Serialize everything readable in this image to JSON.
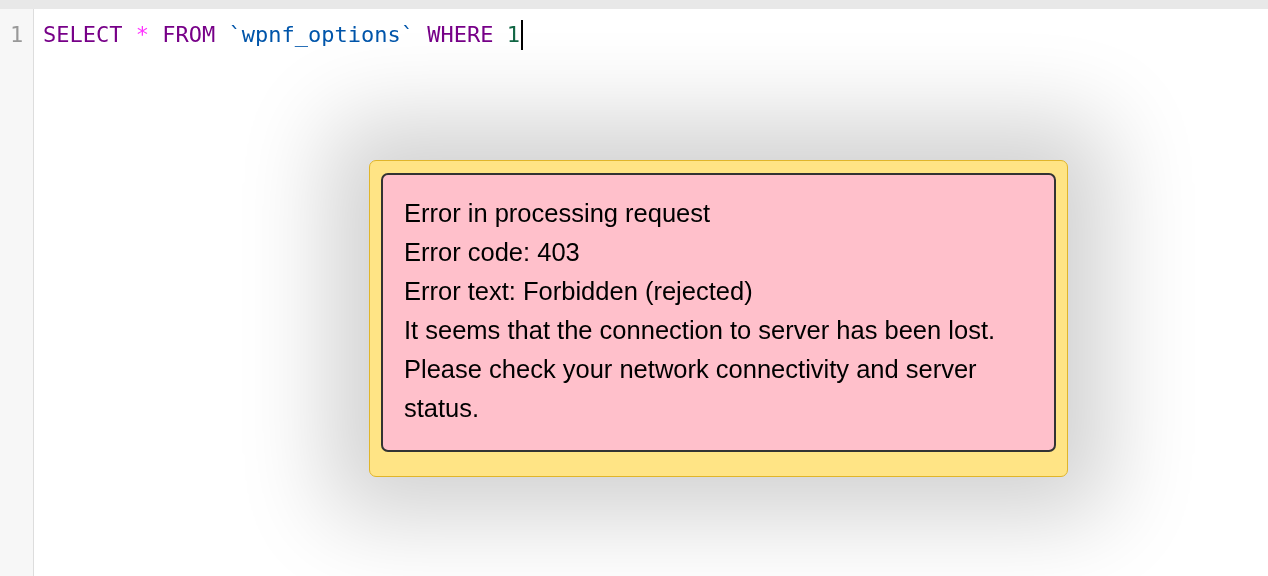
{
  "editor": {
    "line_number": "1",
    "tokens": [
      {
        "text": "SELECT",
        "kind": "keyword"
      },
      {
        "text": "*",
        "kind": "operator"
      },
      {
        "text": "FROM",
        "kind": "keyword"
      },
      {
        "text": "`wpnf_options`",
        "kind": "identifier"
      },
      {
        "text": "WHERE",
        "kind": "keyword"
      },
      {
        "text": "1",
        "kind": "number"
      }
    ]
  },
  "error_dialog": {
    "lines": [
      "Error in processing request",
      "Error code: 403",
      "Error text: Forbidden (rejected)",
      "It seems that the connection to server has been lost.",
      "Please check your network connectivity and server status."
    ]
  }
}
